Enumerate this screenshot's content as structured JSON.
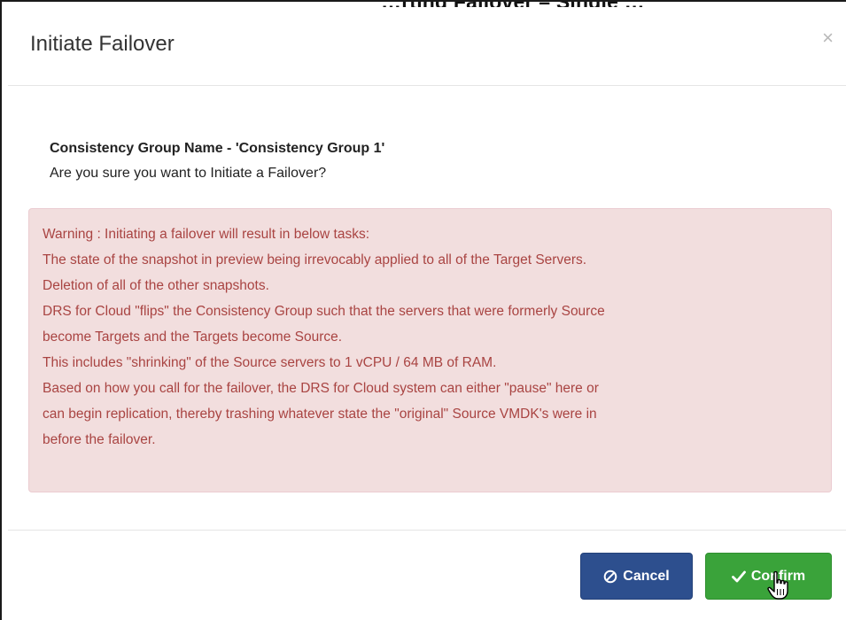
{
  "background_text": "…rting Failover – Single …",
  "modal": {
    "title": "Initiate Failover",
    "close_label": "×",
    "group_name": "Consistency Group Name - 'Consistency Group 1'",
    "question": "Are you sure you want to Initiate a Failover?",
    "warning_lines": [
      "Warning : Initiating a failover will result in below tasks:",
      "The state of the snapshot in preview being irrevocably applied to all of the Target Servers.",
      "Deletion of all of the other snapshots.",
      "DRS for Cloud \"flips\" the Consistency Group such that the servers that were formerly Source",
      "become Targets and the Targets become Source.",
      "This includes \"shrinking\" of the Source servers to 1 vCPU / 64 MB of RAM.",
      "Based on how you call for the failover, the DRS for Cloud system can either \"pause\" here or",
      "can begin replication, thereby trashing whatever state the \"original\" Source VMDK's were in",
      "before the failover."
    ],
    "buttons": {
      "cancel_label": "Cancel",
      "cancel_icon": "ban-icon",
      "confirm_label": "Confirm",
      "confirm_icon": "check-icon"
    }
  },
  "colors": {
    "alert_bg": "#f2dede",
    "alert_text": "#a94442",
    "cancel_bg": "#2d4f8e",
    "confirm_bg": "#3aa33a"
  },
  "cursor": "hand-pointer-icon"
}
